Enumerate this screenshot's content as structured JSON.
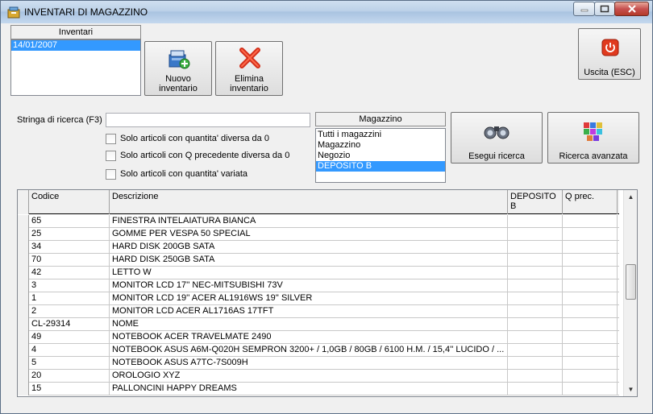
{
  "window": {
    "title": "INVENTARI DI MAGAZZINO",
    "icon": "inventory-app-icon"
  },
  "inventari": {
    "header": "Inventari",
    "items": [
      "14/01/2007"
    ],
    "selected": "14/01/2007"
  },
  "toolbar": {
    "nuovo_line1": "Nuovo",
    "nuovo_line2": "inventario",
    "elimina_line1": "Elimina",
    "elimina_line2": "inventario",
    "uscita": "Uscita (ESC)"
  },
  "search": {
    "label": "Stringa di ricerca (F3)",
    "value": "",
    "checkboxes": [
      {
        "label": "Solo articoli con quantita' diversa da 0",
        "checked": false
      },
      {
        "label": "Solo articoli con Q precedente diversa da 0",
        "checked": false
      },
      {
        "label": "Solo articoli con quantita' variata",
        "checked": false
      }
    ],
    "esegui": "Esegui ricerca",
    "avanzata": "Ricerca avanzata"
  },
  "magazzino": {
    "header": "Magazzino",
    "items": [
      "Tutti i magazzini",
      "Magazzino",
      "Negozio",
      "DEPOSITO B"
    ],
    "selected": "DEPOSITO B"
  },
  "grid": {
    "columns": [
      "Codice",
      "Descrizione",
      "DEPOSITO B",
      "Q prec."
    ],
    "rows": [
      [
        "65",
        "FINESTRA INTELAIATURA BIANCA",
        "",
        ""
      ],
      [
        "25",
        "GOMME PER VESPA 50 SPECIAL",
        "",
        ""
      ],
      [
        "34",
        "HARD DISK 200GB SATA",
        "",
        ""
      ],
      [
        "70",
        "HARD DISK 250GB SATA",
        "",
        ""
      ],
      [
        "42",
        "LETTO W",
        "",
        ""
      ],
      [
        "3",
        "MONITOR LCD 17'' NEC-MITSUBISHI 73V",
        "",
        ""
      ],
      [
        "1",
        "MONITOR LCD 19'' ACER AL1916WS 19'' SILVER",
        "",
        ""
      ],
      [
        "2",
        "MONITOR LCD ACER AL1716AS 17TFT",
        "",
        ""
      ],
      [
        "CL-29314",
        "NOME",
        "",
        ""
      ],
      [
        "49",
        "NOTEBOOK ACER TRAVELMATE 2490",
        "",
        ""
      ],
      [
        "4",
        "NOTEBOOK ASUS A6M-Q020H SEMPRON 3200+ / 1,0GB / 80GB / 6100 H.M. / 15,4'' LUCIDO / ...",
        "",
        ""
      ],
      [
        "5",
        "NOTEBOOK ASUS A7TC-7S009H",
        "",
        ""
      ],
      [
        "20",
        "OROLOGIO XYZ",
        "",
        ""
      ],
      [
        "15",
        "PALLONCINI HAPPY DREAMS",
        "",
        ""
      ]
    ]
  }
}
